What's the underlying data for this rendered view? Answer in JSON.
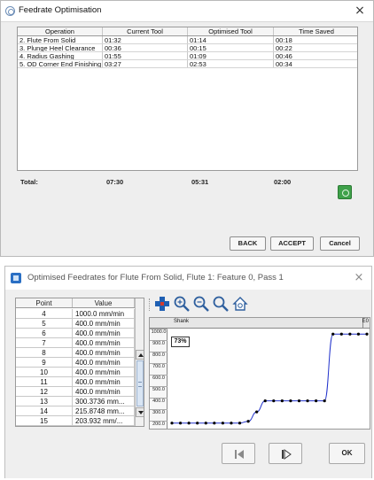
{
  "dialog1": {
    "title": "Feedrate Optimisation",
    "close_glyph": "×",
    "columns": [
      "Operation",
      "Current Tool",
      "Optimised Tool",
      "Time Saved"
    ],
    "rows": [
      [
        "2. Flute From Solid",
        "01:32",
        "01:14",
        "00:18"
      ],
      [
        "3. Plunge Heel Clearance",
        "00:36",
        "00:15",
        "00:22"
      ],
      [
        "4. Radius Gashing",
        "01:55",
        "01:09",
        "00:46"
      ],
      [
        "5. OD Corner End Finishing",
        "03:27",
        "02:53",
        "00:34"
      ]
    ],
    "totals": {
      "label": "Total:",
      "current": "07:30",
      "optimised": "05:31",
      "saved": "02:00"
    },
    "buttons": {
      "back": "BACK",
      "accept": "ACCEPT",
      "cancel": "Cancel"
    },
    "icons": {
      "title": "spiral-icon",
      "action": "green-refresh-icon"
    }
  },
  "dialog2": {
    "title": "Optimised Feedrates for Flute From Solid, Flute 1: Feature 0, Pass 1",
    "close_glyph": "×",
    "table": {
      "columns": [
        "Point",
        "Value"
      ],
      "rows": [
        [
          "4",
          "1000.0 mm/min"
        ],
        [
          "5",
          "400.0 mm/min"
        ],
        [
          "6",
          "400.0 mm/min"
        ],
        [
          "7",
          "400.0 mm/min"
        ],
        [
          "8",
          "400.0 mm/min"
        ],
        [
          "9",
          "400.0 mm/min"
        ],
        [
          "10",
          "400.0 mm/min"
        ],
        [
          "11",
          "400.0 mm/min"
        ],
        [
          "12",
          "400.0 mm/min"
        ],
        [
          "13",
          "300.3736 mm..."
        ],
        [
          "14",
          "215.8748 mm..."
        ],
        [
          "15",
          "203.932 mm/..."
        ]
      ]
    },
    "toolbar": [
      "add-point-icon",
      "zoom-in-icon",
      "zoom-out-icon",
      "zoom-fit-icon",
      "home-icon"
    ],
    "chart": {
      "band_left": "Shank",
      "band_right": "E0",
      "y_ticks": [
        "1000.0",
        "900.0",
        "800.0",
        "700.0",
        "600.0",
        "500.0",
        "400.0",
        "300.0",
        "200.0"
      ],
      "percent": "73%",
      "line_color": "#2233cc"
    },
    "buttons": {
      "ok": "OK",
      "prev": "previous-icon",
      "next": "next-icon"
    }
  },
  "chart_data": {
    "type": "line",
    "y": [
      200,
      200,
      200,
      200,
      200,
      200,
      200,
      200,
      200,
      215.87,
      300.37,
      400,
      400,
      400,
      400,
      400,
      400,
      400,
      400,
      1000,
      1000,
      1000,
      1000,
      1000
    ],
    "ylim": [
      150,
      1050
    ],
    "ytick_labels": [
      "1000.0",
      "900.0",
      "800.0",
      "700.0",
      "600.0",
      "500.0",
      "400.0",
      "300.0",
      "200.0"
    ],
    "top_labels": [
      "Shank",
      "E0"
    ],
    "annotation": "73%"
  }
}
